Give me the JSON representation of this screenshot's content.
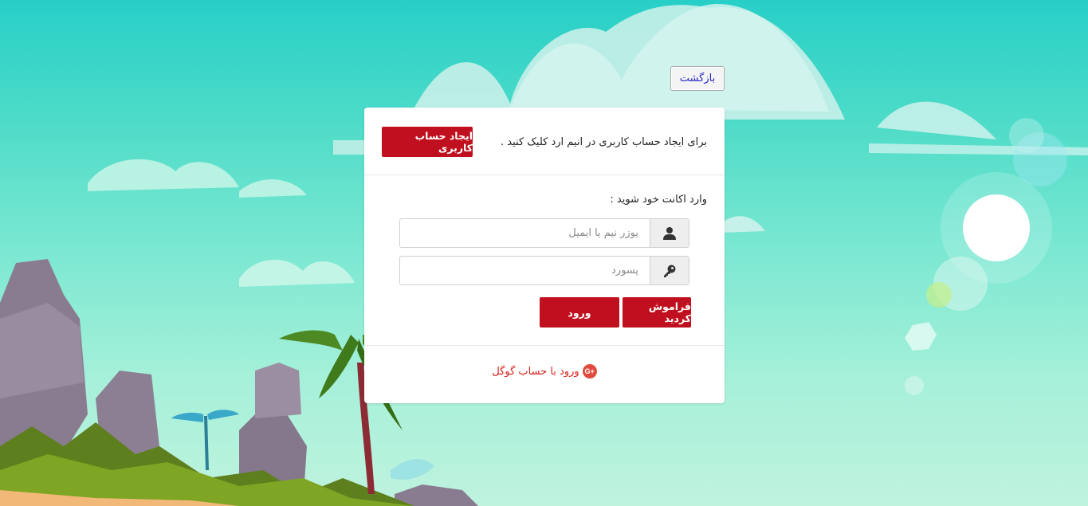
{
  "back_button": {
    "label": "بازگشت"
  },
  "signup": {
    "prompt": "برای ایجاد حساب کاربری در انیم ارد کلیک کنید .",
    "button_label": "ایجاد حساب کاربری"
  },
  "login": {
    "title": "وارد اکانت خود شوید :",
    "username_placeholder": "یوزر نیم یا ایمیل",
    "password_placeholder": "پسورد",
    "forgot_label": "فراموش کردید",
    "submit_label": "ورود"
  },
  "google": {
    "label": "ورود با حساب گوگل",
    "icon_text": "G+"
  },
  "colors": {
    "accent": "#c0101f",
    "google": "#d8231d",
    "link": "#2a2acb"
  },
  "icons": {
    "user": "user-icon",
    "key": "key-icon",
    "google": "google-plus-icon"
  }
}
